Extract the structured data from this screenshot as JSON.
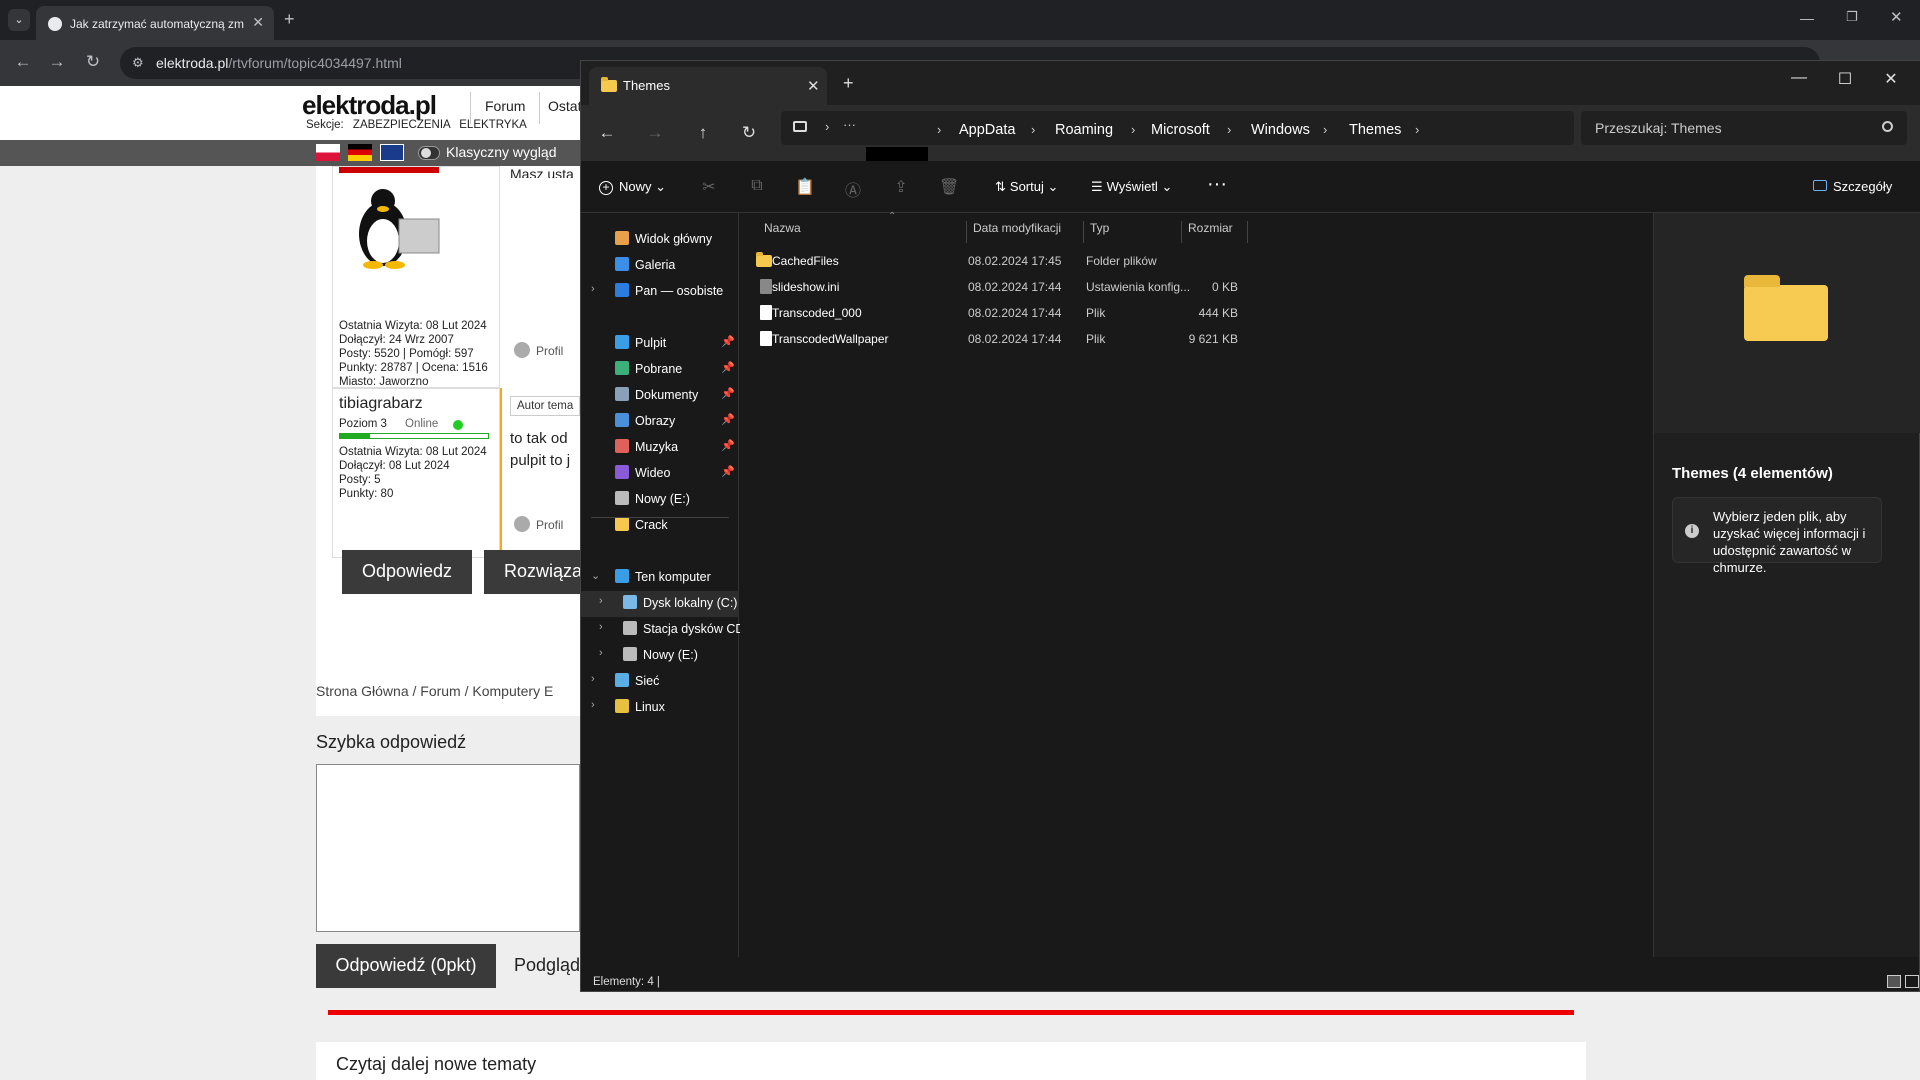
{
  "browser": {
    "tab_title": "Jak zatrzymać automatyczną zm",
    "url_domain": "elektroda.pl",
    "url_path": "/rtvforum/topic4034497.html"
  },
  "site": {
    "logo": "elektroda.pl",
    "nav_forum": "Forum",
    "nav_ost": "Ostat",
    "sections_label": "Sekcje:",
    "sections": [
      "ZABEZPIECZENIA",
      "ELEKTRYKA"
    ],
    "classic_view_label": "Klasyczny wygląd",
    "user1": {
      "last_visit": "Ostatnia Wizyta: 08 Lut 2024",
      "joined": "Dołączył: 24 Wrz 2007",
      "posts": "Posty: 5520 | Pomógł: 597",
      "points": "Punkty: 28787 | Ocena: 1516",
      "city": "Miasto: Jaworzno",
      "snippet": "Masz usta"
    },
    "user2": {
      "name": "tibiagrabarz",
      "level": "Poziom 3",
      "status": "Online",
      "last_visit": "Ostatnia Wizyta: 08 Lut 2024",
      "joined": "Dołączył: 08 Lut 2024",
      "posts": "Posty: 5",
      "points": "Punkty: 80",
      "author_badge": "Autor tema",
      "post_line1": "to tak od",
      "post_line2": "pulpit to j"
    },
    "profile_label": "Profil",
    "reply_button": "Odpowiedz",
    "solved_button": "Rozwiązan",
    "breadcrumb": "Strona Główna  /  Forum  /  Komputery E",
    "quick_reply_title": "Szybka odpowiedź",
    "reply_points_button": "Odpowiedź (0pkt)",
    "preview_link": "Podgląd",
    "read_more": "Czytaj dalej nowe tematy"
  },
  "explorer": {
    "tab_title": "Themes",
    "breadcrumbs": [
      "AppData",
      "Roaming",
      "Microsoft",
      "Windows",
      "Themes"
    ],
    "search_placeholder": "Przeszukaj: Themes",
    "cmd": {
      "new": "Nowy",
      "sort": "Sortuj",
      "view": "Wyświetl",
      "details": "Szczegóły"
    },
    "sidebar": [
      {
        "label": "Widok główny",
        "icon": "home-icon",
        "color": "#e8a04a"
      },
      {
        "label": "Galeria",
        "icon": "gallery-icon",
        "color": "#3a8ee6"
      },
      {
        "label": "Pan — osobiste",
        "icon": "onedrive-icon",
        "color": "#2b7de0"
      },
      {
        "label": "Pulpit",
        "icon": "desktop-icon",
        "color": "#3a9ee6"
      },
      {
        "label": "Pobrane",
        "icon": "download-icon",
        "color": "#3ab07a"
      },
      {
        "label": "Dokumenty",
        "icon": "documents-icon",
        "color": "#8aa0b8"
      },
      {
        "label": "Obrazy",
        "icon": "pictures-icon",
        "color": "#4a90d9"
      },
      {
        "label": "Muzyka",
        "icon": "music-icon",
        "color": "#e0605a"
      },
      {
        "label": "Wideo",
        "icon": "video-icon",
        "color": "#8a5ad9"
      },
      {
        "label": "Nowy (E:)",
        "icon": "drive-icon",
        "color": "#bbbbbb"
      },
      {
        "label": "Crack",
        "icon": "folder-icon",
        "color": "#f6c94e"
      },
      {
        "label": "Ten komputer",
        "icon": "computer-icon",
        "color": "#3a9ee6"
      },
      {
        "label": "Dysk lokalny (C:)",
        "icon": "drive-c-icon",
        "color": "#7ab8e6"
      },
      {
        "label": "Stacja dysków CD",
        "icon": "cd-drive-icon",
        "color": "#bbbbbb"
      },
      {
        "label": "Nowy (E:)",
        "icon": "drive-icon",
        "color": "#bbbbbb"
      },
      {
        "label": "Sieć",
        "icon": "network-icon",
        "color": "#5aaee6"
      },
      {
        "label": "Linux",
        "icon": "linux-icon",
        "color": "#e8c040"
      }
    ],
    "columns": [
      "Nazwa",
      "Data modyfikacji",
      "Typ",
      "Rozmiar"
    ],
    "files": [
      {
        "name": "CachedFiles",
        "date": "08.02.2024 17:45",
        "type": "Folder plików",
        "size": ""
      },
      {
        "name": "slideshow.ini",
        "date": "08.02.2024 17:44",
        "type": "Ustawienia konfig...",
        "size": "0 KB"
      },
      {
        "name": "Transcoded_000",
        "date": "08.02.2024 17:44",
        "type": "Plik",
        "size": "444 KB"
      },
      {
        "name": "TranscodedWallpaper",
        "date": "08.02.2024 17:44",
        "type": "Plik",
        "size": "9 621 KB"
      }
    ],
    "details_title": "Themes (4 elementów)",
    "details_info": "Wybierz jeden plik, aby uzyskać więcej informacji i udostępnić zawartość w chmurze.",
    "status": "Elementy: 4  |"
  }
}
